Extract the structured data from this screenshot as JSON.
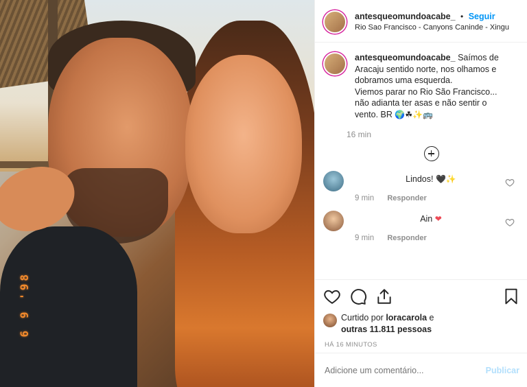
{
  "photo": {
    "stamp": "6 9 '98"
  },
  "post": {
    "username": "antesqueomundoacabe_",
    "separator": "•",
    "follow_label": "Seguir",
    "location": "Rio Sao Francisco - Canyons Caninde - Xingu",
    "caption_lines": [
      "Saímos de",
      "Aracaju sentido norte, nos olhamos e",
      "dobramos uma esquerda.",
      "Viemos parar no Rio São Francisco...",
      "não adianta ter asas e não sentir o",
      "vento. BR"
    ],
    "caption_emojis": "🌍☘✨🚌",
    "caption_time": "16 min"
  },
  "comments": [
    {
      "text": "Lindos! ",
      "emoji": "🖤✨",
      "time": "9 min",
      "reply_label": "Responder"
    },
    {
      "text": "Ain ",
      "emoji": "❤",
      "time": "9 min",
      "reply_label": "Responder"
    }
  ],
  "likes": {
    "prefix": "Curtido por ",
    "user": "loracarola",
    "mid": " e",
    "others": "outras 11.811 pessoas"
  },
  "age": "HÁ 16 MINUTOS",
  "add_comment": {
    "placeholder": "Adicione um comentário...",
    "publish_label": "Publicar"
  },
  "icons": {
    "like": "heart-outline-icon",
    "comment": "speech-bubble-icon",
    "share": "share-upload-icon",
    "save": "bookmark-icon",
    "more": "plus-circle-icon"
  },
  "colors": {
    "follow": "#0095f6",
    "publish_disabled": "#b2dffc",
    "muted": "#8e8e8e"
  }
}
